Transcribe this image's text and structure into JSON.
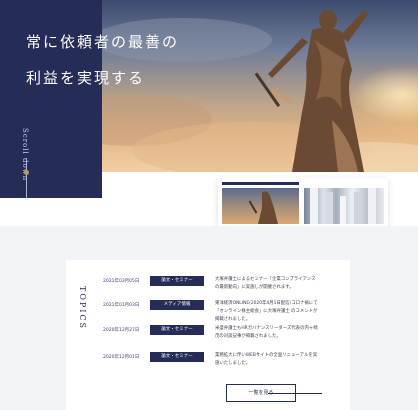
{
  "hero": {
    "headline_line1": "常に依頼者の最善の",
    "headline_line2": "利益を実現する",
    "vertical_label": "Scroll down"
  },
  "topics": {
    "title": "TOPICS",
    "items": [
      {
        "date": "2021年03月05日",
        "category": "論文・セミナー",
        "text": "大塚弁護士によるセミナー「企業コンプライアンスの最新動向」に実施しが開催されます。"
      },
      {
        "date": "2021年01月03日",
        "category": "メディア情報",
        "text": "東洋経済ONLINE(2020年4月1日配信)コロナ禍にて「オンライン株主総会」に大塚弁護士 のコメントが掲載されました。"
      },
      {
        "date": "2020年12月27日",
        "category": "論文・セミナー",
        "text": "米盛弁護士もHRガバナンスリーダーズ代表の内ヶ崎茂の対談記事が掲載されました。"
      },
      {
        "date": "2020年12月01日",
        "category": "論文・セミナー",
        "text": "業務拡大に伴いWEBサイトの全面リニューアルを実施いたしました。"
      }
    ],
    "more_label": "一覧を見る"
  },
  "colors": {
    "navy": "#252c58",
    "accent_gold": "#b99767",
    "topics_bg": "#f3f4f7"
  }
}
